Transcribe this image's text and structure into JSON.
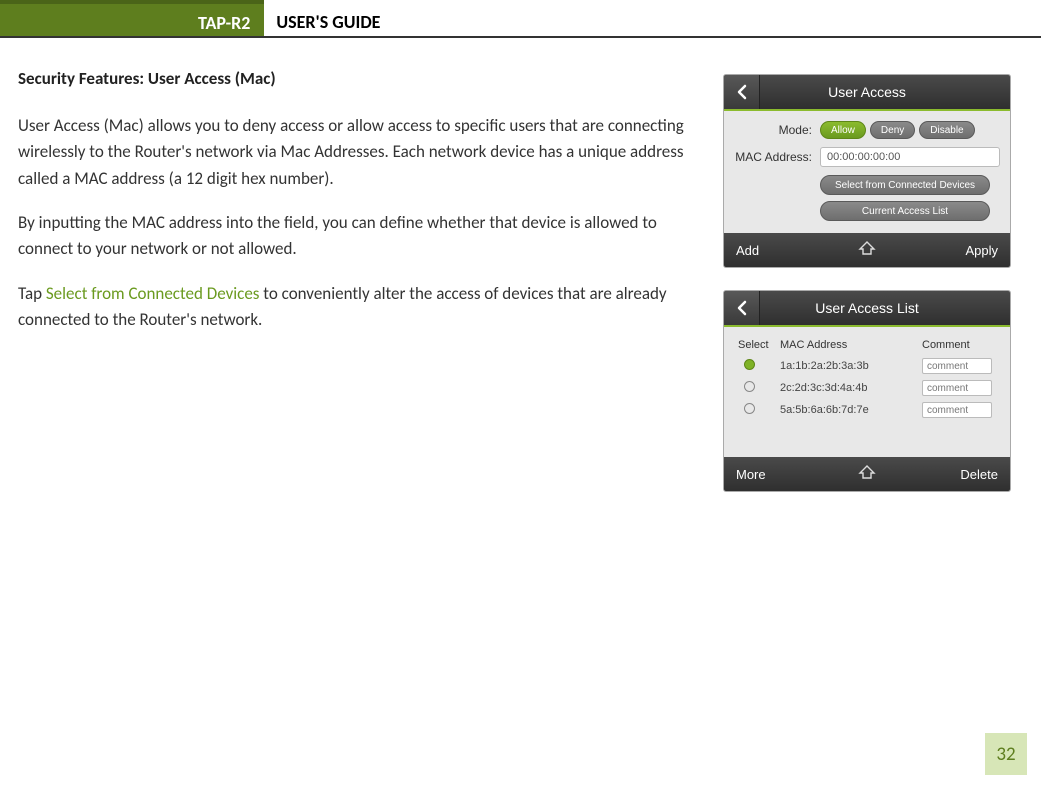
{
  "header": {
    "badge": "TAP-R2",
    "title": "USER'S GUIDE"
  },
  "section_heading": "Security Features: User Access (Mac)",
  "para1": "User Access (Mac) allows you to deny access or allow access to specific users that are connecting wirelessly to the Router's network via Mac Addresses. Each network device has a unique address called a MAC address (a 12 digit hex number).",
  "para2": "By inputting the MAC address into the field, you can define whether that device is allowed to connect to your network or not allowed.",
  "para3_pre": "Tap ",
  "para3_link": "Select from Connected Devices",
  "para3_post": " to conveniently alter the access of devices that are already connected to the Router's network.",
  "shot1": {
    "title": "User Access",
    "mode_label": "Mode:",
    "allow": "Allow",
    "deny": "Deny",
    "disable": "Disable",
    "mac_label": "MAC Address:",
    "mac_value": "00:00:00:00:00",
    "btn_select": "Select from Connected Devices",
    "btn_current": "Current Access List",
    "bottom_left": "Add",
    "bottom_right": "Apply"
  },
  "shot2": {
    "title": "User Access List",
    "h_select": "Select",
    "h_mac": "MAC Address",
    "h_comment": "Comment",
    "rows": [
      {
        "mac": "1a:1b:2a:2b:3a:3b",
        "comment": "comment",
        "selected": true
      },
      {
        "mac": "2c:2d:3c:3d:4a:4b",
        "comment": "comment",
        "selected": false
      },
      {
        "mac": "5a:5b:6a:6b:7d:7e",
        "comment": "comment",
        "selected": false
      }
    ],
    "bottom_left": "More",
    "bottom_right": "Delete"
  },
  "page_number": "32"
}
